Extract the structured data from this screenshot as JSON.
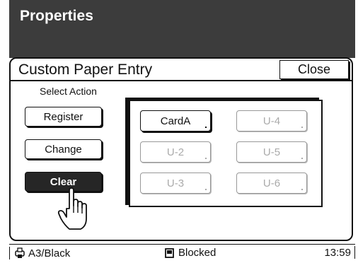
{
  "window": {
    "title": "Properties"
  },
  "panel": {
    "title": "Custom Paper Entry",
    "close_label": "Close",
    "select_label": "Select Action",
    "actions": [
      {
        "label": "Register",
        "active": false
      },
      {
        "label": "Change",
        "active": false
      },
      {
        "label": "Clear",
        "active": true
      }
    ],
    "paper_slots": [
      {
        "label": "CardA",
        "enabled": true
      },
      {
        "label": "U-4",
        "enabled": false
      },
      {
        "label": "U-2",
        "enabled": false
      },
      {
        "label": "U-5",
        "enabled": false
      },
      {
        "label": "U-3",
        "enabled": false
      },
      {
        "label": "U-6",
        "enabled": false
      }
    ]
  },
  "status": {
    "paper": "A3/Black",
    "paper_icon": "printer-icon",
    "state": "Blocked",
    "state_icon": "document-icon",
    "time": "13:59"
  },
  "colors": {
    "titlebar": "#3c3c3c",
    "active_button": "#262626",
    "disabled_text": "#aaaaaa"
  }
}
